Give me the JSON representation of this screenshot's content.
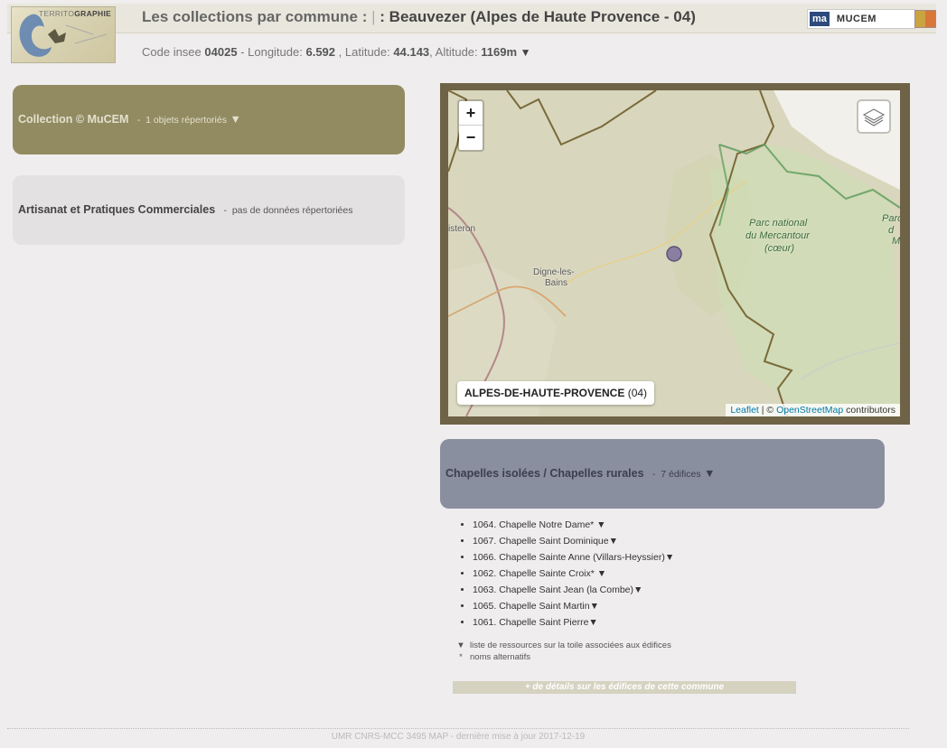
{
  "header": {
    "logo_text_light": "TERRITO",
    "logo_text_bold": "GRAPHIE",
    "title_prefix": "Les collections par commune :",
    "title_separator": "|",
    "title_commune": ": Beauvezer (Alpes de Haute Provence - 04)",
    "partner_mp": "ma",
    "partner_mucem": "MUCEM"
  },
  "info": {
    "code_label": "Code insee",
    "code_value": "04025",
    "lon_label": "- Longitude:",
    "lon_value": "6.592",
    "lat_label": ", Latitude:",
    "lat_value": "44.143",
    "alt_label": ", Altitude:",
    "alt_value": "1169m",
    "arrow": "▼"
  },
  "panels": {
    "mucem": {
      "title": "Collection © MuCEM",
      "sep": "-",
      "count": "1 objets répertoriés",
      "arrow": "▼"
    },
    "craft": {
      "title": "Artisanat et Pratiques Commerciales",
      "sep": "-",
      "status": "pas de données répertoriées"
    },
    "chapels": {
      "title": "Chapelles isolées / Chapelles rurales",
      "sep": "-",
      "count": "7 édifices",
      "arrow": "▼"
    }
  },
  "map": {
    "zoom_in": "+",
    "zoom_out": "−",
    "region_label": "ALPES-DE-HAUTE-PROVENCE",
    "region_code": "(04)",
    "attribution_leaflet": "Leaflet",
    "attribution_sep": "| ©",
    "attribution_osm": "OpenStreetMap",
    "attribution_contrib": "contributors",
    "places": {
      "sisteron": "isteron",
      "digne_1": "Digne-les-",
      "digne_2": "Bains",
      "park_1": "Parc national",
      "park_2": "du Mercantour",
      "park_3": "(cœur)",
      "parc_right_1": "Parc",
      "parc_right_2": "d",
      "parc_right_3": "M"
    },
    "colors": {
      "marker": "#8a7fa0",
      "border": "#7a6a3a",
      "park_border": "#5a9a5a"
    }
  },
  "chapels": [
    {
      "text": "1064. Chapelle Notre Dame*",
      "arrow": " ▼"
    },
    {
      "text": "1067. Chapelle Saint Dominique",
      "arrow": "▼"
    },
    {
      "text": "1066. Chapelle Sainte Anne (Villars-Heyssier)",
      "arrow": "▼"
    },
    {
      "text": "1062. Chapelle Sainte Croix*",
      "arrow": " ▼"
    },
    {
      "text": "1063. Chapelle Saint Jean (la Combe)",
      "arrow": "▼"
    },
    {
      "text": "1065. Chapelle Saint Martin",
      "arrow": "▼"
    },
    {
      "text": "1061. Chapelle Saint Pierre",
      "arrow": "▼"
    }
  ],
  "legend": [
    {
      "sym": "▼",
      "text": "liste de ressources sur la toile associées aux édifices"
    },
    {
      "sym": "*",
      "text": "noms alternatifs"
    }
  ],
  "details_link": "+ de détails sur les édifices de cette commune",
  "footer": "UMR CNRS-MCC 3495 MAP - dernière mise à jour 2017-12-19"
}
